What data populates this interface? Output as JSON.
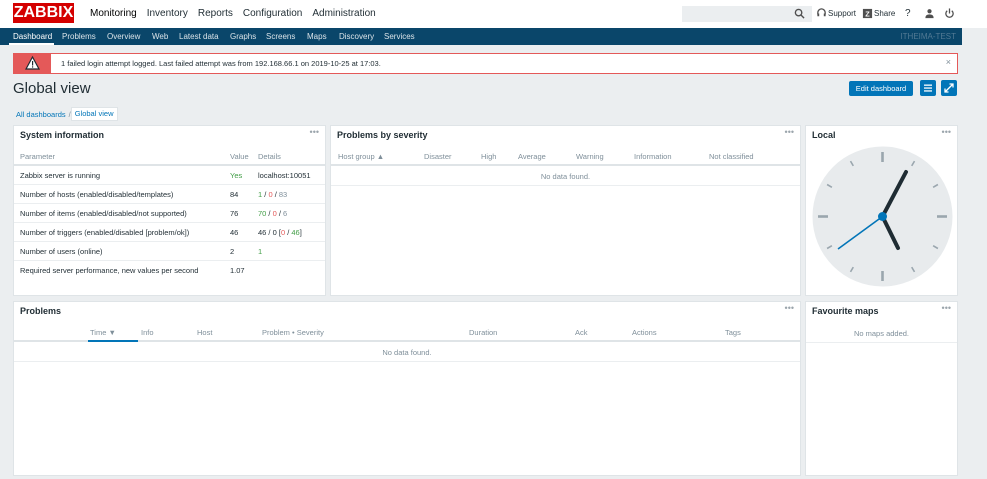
{
  "header": {
    "logo": "ZABBIX",
    "menu": [
      {
        "label": "Monitoring",
        "active": true
      },
      {
        "label": "Inventory"
      },
      {
        "label": "Reports"
      },
      {
        "label": "Configuration"
      },
      {
        "label": "Administration"
      }
    ],
    "search_placeholder": "",
    "support_label": "Support",
    "share_label": "Share",
    "help_label": "?"
  },
  "subnav": {
    "items": [
      "Dashboard",
      "Problems",
      "Overview",
      "Web",
      "Latest data",
      "Graphs",
      "Screens",
      "Maps",
      "Discovery",
      "Services"
    ],
    "server_name": "ITHEIMA-TEST"
  },
  "alert": {
    "message": "1 failed login attempt logged. Last failed attempt was from 192.168.66.1 on 2019-10-25 at 17:03.",
    "close": "×"
  },
  "page": {
    "title": "Global view",
    "edit_button": "Edit dashboard"
  },
  "breadcrumb": {
    "items": [
      "All dashboards",
      "Global view"
    ],
    "separator": "/"
  },
  "system_info": {
    "title": "System information",
    "menu": "•••",
    "columns": [
      "Parameter",
      "Value",
      "Details"
    ],
    "rows": [
      {
        "parameter": "Zabbix server is running",
        "value": "Yes",
        "details": "localhost:10051"
      },
      {
        "parameter": "Number of hosts (enabled/disabled/templates)",
        "value": "84",
        "d1": "1",
        "d2": "0",
        "d3": "83"
      },
      {
        "parameter": "Number of items (enabled/disabled/not supported)",
        "value": "76",
        "d1": "70",
        "d2": "0",
        "d3": "6"
      },
      {
        "parameter": "Number of triggers (enabled/disabled [problem/ok])",
        "value": "46",
        "d1": "46",
        "d2": "0",
        "d3": "0",
        "d4": "46"
      },
      {
        "parameter": "Number of users (online)",
        "value": "2",
        "details": "1"
      },
      {
        "parameter": "Required server performance, new values per second",
        "value": "1.07",
        "details": ""
      }
    ]
  },
  "problems_by_severity": {
    "title": "Problems by severity",
    "menu": "•••",
    "columns": [
      "Host group ▲",
      "Disaster",
      "High",
      "Average",
      "Warning",
      "Information",
      "Not classified"
    ],
    "empty": "No data found."
  },
  "clock": {
    "title": "Local",
    "menu": "•••"
  },
  "problems": {
    "title": "Problems",
    "menu": "•••",
    "columns": [
      "Time ▼",
      "Info",
      "Host",
      "Problem • Severity",
      "Duration",
      "Ack",
      "Actions",
      "Tags"
    ],
    "empty": "No data found."
  },
  "fav_maps": {
    "title": "Favourite maps",
    "menu": "•••",
    "empty": "No maps added."
  },
  "colors": {
    "brand_red": "#d40000",
    "nav_blue": "#0a466a",
    "accent_blue": "#0275b8",
    "alert_red": "#e45959",
    "ok_green": "#429e47"
  }
}
